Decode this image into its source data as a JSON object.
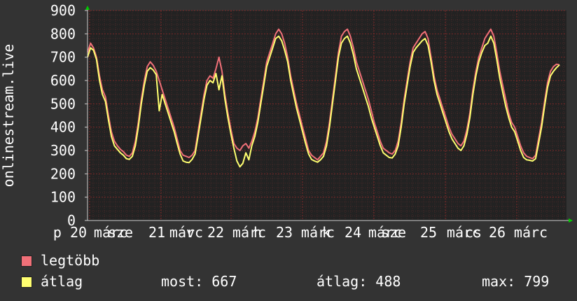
{
  "chart_data": {
    "type": "line",
    "ylabel": "onlinestream.live",
    "ylim": [
      0,
      900
    ],
    "yticks": [
      0,
      100,
      200,
      300,
      400,
      500,
      600,
      700,
      800,
      900
    ],
    "xtick_labels": [
      "p 20",
      "márc",
      "sze",
      "21",
      "márc",
      "v",
      "22",
      "márc",
      "h",
      "23",
      "márc",
      "k",
      "24",
      "márc",
      "sze",
      "25",
      "márc",
      "cs",
      "26",
      "márc"
    ],
    "grid": true,
    "legend_placement": "bottom-left",
    "colors": {
      "background": "#333333",
      "plot_bg": "#222222",
      "grid": "#5a2020",
      "axis": "#cccccc",
      "text": "#ffffff",
      "max": "#f07078",
      "avg": "#ffff70",
      "arrow": "#00cc00"
    },
    "series": [
      {
        "name": "legtöbb",
        "color": "#f07078",
        "values": [
          720,
          760,
          740,
          700,
          620,
          560,
          530,
          450,
          380,
          340,
          320,
          305,
          295,
          280,
          275,
          290,
          340,
          420,
          520,
          600,
          660,
          680,
          665,
          640,
          600,
          560,
          520,
          480,
          440,
          400,
          350,
          300,
          280,
          275,
          270,
          280,
          300,
          380,
          460,
          540,
          600,
          620,
          610,
          650,
          700,
          640,
          540,
          460,
          390,
          330,
          310,
          300,
          320,
          330,
          310,
          340,
          380,
          440,
          520,
          600,
          680,
          720,
          760,
          800,
          820,
          800,
          760,
          700,
          620,
          560,
          500,
          450,
          400,
          350,
          300,
          280,
          270,
          260,
          275,
          290,
          340,
          420,
          520,
          620,
          720,
          790,
          810,
          820,
          790,
          740,
          680,
          640,
          600,
          560,
          520,
          470,
          420,
          380,
          340,
          310,
          300,
          290,
          285,
          300,
          340,
          420,
          520,
          600,
          680,
          740,
          760,
          780,
          800,
          810,
          780,
          700,
          620,
          560,
          520,
          480,
          440,
          400,
          370,
          350,
          330,
          320,
          340,
          390,
          460,
          560,
          640,
          700,
          740,
          780,
          800,
          820,
          790,
          720,
          640,
          580,
          520,
          460,
          420,
          400,
          360,
          320,
          290,
          275,
          270,
          265,
          280,
          350,
          420,
          510,
          590,
          640,
          660,
          670,
          667
        ]
      },
      {
        "name": "átlag",
        "color": "#ffff70",
        "values": [
          700,
          740,
          730,
          690,
          600,
          540,
          510,
          430,
          360,
          320,
          305,
          290,
          280,
          265,
          262,
          275,
          320,
          400,
          500,
          580,
          640,
          655,
          645,
          625,
          470,
          540,
          500,
          460,
          420,
          380,
          330,
          285,
          255,
          250,
          248,
          262,
          285,
          360,
          440,
          520,
          580,
          600,
          590,
          630,
          560,
          620,
          520,
          440,
          370,
          310,
          255,
          230,
          245,
          290,
          260,
          320,
          360,
          420,
          500,
          580,
          660,
          700,
          740,
          780,
          790,
          770,
          730,
          680,
          600,
          540,
          480,
          430,
          380,
          330,
          285,
          262,
          255,
          250,
          260,
          275,
          320,
          400,
          500,
          600,
          700,
          760,
          780,
          790,
          760,
          710,
          650,
          610,
          570,
          530,
          490,
          440,
          400,
          360,
          320,
          290,
          280,
          270,
          268,
          285,
          320,
          400,
          500,
          580,
          660,
          720,
          740,
          755,
          770,
          780,
          750,
          680,
          600,
          540,
          500,
          460,
          420,
          380,
          350,
          330,
          310,
          300,
          320,
          370,
          440,
          540,
          620,
          680,
          720,
          750,
          760,
          790,
          760,
          690,
          610,
          550,
          490,
          440,
          400,
          380,
          340,
          300,
          270,
          260,
          258,
          255,
          265,
          330,
          400,
          490,
          570,
          620,
          640,
          655,
          667
        ]
      }
    ]
  },
  "legend": {
    "max_label": "legtöbb",
    "avg_label": "átlag",
    "now_text": "most: 667",
    "avg_text": "átlag: 488",
    "max_text": "max: 799"
  }
}
